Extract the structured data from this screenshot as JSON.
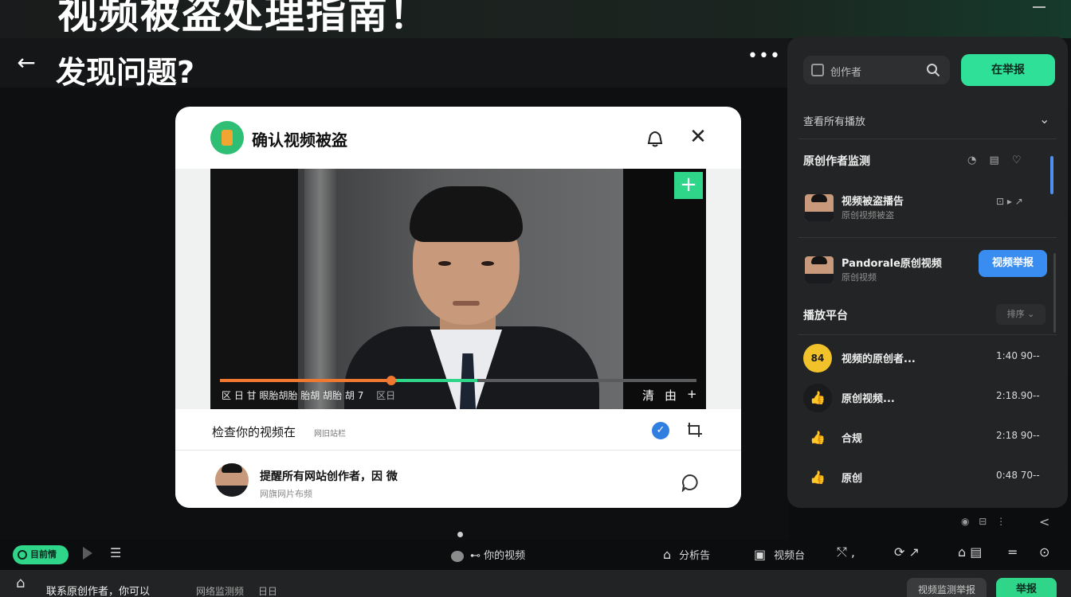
{
  "banner": {
    "title": "视频被盗处理指南！"
  },
  "header": {
    "back_glyph": "←",
    "heading": "发现问题?",
    "more_glyph": "•••"
  },
  "dialog": {
    "title": "确认视频被盗",
    "close_glyph": "✕",
    "video": {
      "add_glyph": "+",
      "progress_percent": 36,
      "buffer_percent": 54,
      "caption": "区 日 甘 眼胎胡胎 胎胡 胡胎 胡 7",
      "caption_tail": "区日",
      "controls": [
        "清",
        "由",
        "+"
      ]
    },
    "check": {
      "text": "检查你的视频在",
      "hint": "网旧站栏",
      "checked_glyph": "✓"
    },
    "comment": {
      "name": "提醒所有网站创作者，因 微",
      "sub": "网旗网片布频"
    }
  },
  "panel": {
    "search_placeholder": "创作者",
    "cta_label": "在举报",
    "section_label": "查看所有播放",
    "chevron_glyph": "⌄",
    "list_heading": "原创作者监测",
    "list_tools": "◔ ▤ ♡",
    "items": [
      {
        "title": "视频被盗播告",
        "sub": "原创视频被盗",
        "action": "⊡ ▸ ↗"
      },
      {
        "title": "Pandorale原创视频",
        "sub": "原创视频",
        "button": "视频举报"
      }
    ],
    "platform_heading": "播放平台",
    "sort_label": "排序 ⌄",
    "rows": [
      {
        "icon": "84",
        "label": "视频的原创者...",
        "time": "1:40 90--",
        "icon_bg": "#f2c22a",
        "icon_color": "#1a1a1a"
      },
      {
        "icon": "👍",
        "label": "原创视频...",
        "time": "2:18.90--",
        "icon_bg": "#1a1b1c",
        "icon_color": "#ffffff"
      },
      {
        "icon": "👍",
        "label": "合规",
        "time": "2:18 90--",
        "icon_bg": "transparent",
        "icon_color": "#e6e8e7"
      },
      {
        "icon": "👍",
        "label": "原创",
        "time": "0:48 70--",
        "icon_bg": "transparent",
        "icon_color": "#e6e8e7"
      }
    ]
  },
  "status": {
    "mini_icons": "◉ ⊟ ⋮",
    "share_glyph": "<"
  },
  "toolbar": {
    "pill_label": "目前情",
    "list_glyph": "☰",
    "center_label": "⊷ 你的视频",
    "items": [
      {
        "icon": "⌂",
        "label": "分析告"
      },
      {
        "icon": "▣",
        "label": "视频台"
      }
    ],
    "right_icons": [
      "⤲ ,",
      "⟳ ↗",
      "⌂ ▤",
      "=",
      "⊙"
    ]
  },
  "footer": {
    "home_glyph": "⌂",
    "text": "联系原创作者，你可以",
    "text2": "网络监测频",
    "text3": "日日",
    "secondary_button": "视频监测举报",
    "primary_button": "举报"
  }
}
